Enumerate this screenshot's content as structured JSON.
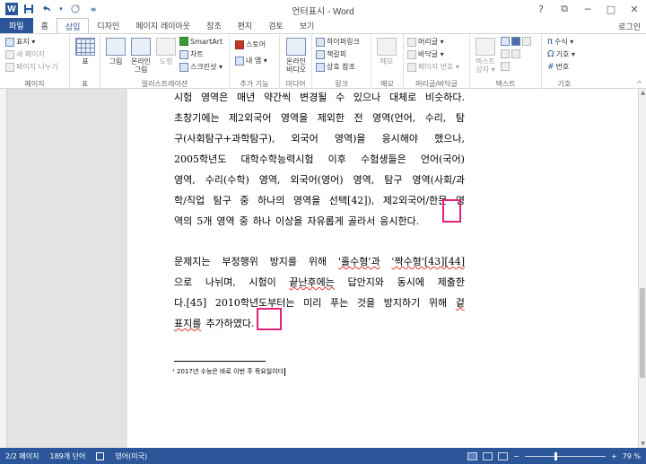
{
  "title_bar": {
    "app_icon": "W",
    "title": "언터표시 - Word",
    "qat_icons": [
      "save-icon",
      "undo-icon",
      "redo-icon",
      "customize-icon"
    ],
    "window_buttons": [
      "?",
      "⧉",
      "─",
      "□",
      "✕"
    ]
  },
  "tabs": [
    {
      "label": "파일"
    },
    {
      "label": "홈"
    },
    {
      "label": "삽입"
    },
    {
      "label": "디자인"
    },
    {
      "label": "페이지 레이아웃"
    },
    {
      "label": "참조"
    },
    {
      "label": "편지"
    },
    {
      "label": "검토"
    },
    {
      "label": "보기"
    }
  ],
  "active_tab": "삽입",
  "login_label": "로그인",
  "ribbon": {
    "pages": {
      "label": "페이지",
      "cover": "표지 ▾",
      "blank": "새 페이지",
      "break": "페이지 나누기"
    },
    "tables": {
      "label": "표",
      "table": "표"
    },
    "illustrations": {
      "label": "일러스트레이션",
      "picture": "그림",
      "online_picture": "온라인 그림",
      "shapes": "도형",
      "smartart": "SmartArt",
      "chart": "차트",
      "screenshot": "스크린샷 ▾"
    },
    "addins": {
      "label": "추가 기능",
      "store": "스토어",
      "my_apps": "내 앱 ▾"
    },
    "media": {
      "label": "미디어",
      "online_video": "온라인 비디오"
    },
    "links": {
      "label": "링크",
      "hyperlink": "하이퍼링크",
      "bookmark": "책갈피",
      "cross_ref": "상호 참조"
    },
    "comments": {
      "label": "메모",
      "comment": "메모"
    },
    "header_footer": {
      "label": "머리글/바닥글",
      "header": "머리글 ▾",
      "footer": "바닥글 ▾",
      "page_number": "페이지 번호 ▾"
    },
    "text": {
      "label": "텍스트",
      "textbox": "텍스트 상자 ▾"
    },
    "symbols": {
      "label": "기호",
      "equation": "수식 ▾",
      "symbol": "기호 ▾",
      "number": "번호"
    }
  },
  "document": {
    "para1": [
      [
        "시험",
        "영역은",
        "매년",
        "약간씩",
        "변경될",
        "수",
        "있으나",
        "대체로",
        "비슷하다."
      ],
      [
        "초창기에는",
        "제2외국어",
        "영역을",
        "제외한",
        "전",
        "영역(언어,",
        "수리,",
        "탐"
      ],
      [
        "구(사회탐구+과학탐구),",
        "외국어",
        "영역)을",
        "응시해야",
        "했으나,"
      ],
      [
        "2005학년도",
        "대학수학능력시험",
        "이후",
        "수험생들은",
        "언어(국어)"
      ],
      [
        "영역,",
        "수리(수학)",
        "영역,",
        "외국어(영어)",
        "영역,",
        "탐구",
        "영역(사회/과"
      ],
      [
        "학/직업",
        "탐구",
        "중",
        "하나의",
        "영역을",
        "선택[42]),",
        "제2외국어/한문",
        "영"
      ]
    ],
    "para1_last": [
      "역의",
      "5개",
      "영역",
      "중",
      "하나",
      "이상을",
      "자유롭게",
      "골라서",
      "응시한다."
    ],
    "para2_l1": [
      "문제지는",
      "부정행위",
      "방지를",
      "위해",
      "'홀수형'과",
      "'짝수형'[43][44]"
    ],
    "para2_l2": [
      "으로",
      "나뉘며,",
      "시험이",
      "끝난후에는",
      "답안지와",
      "동시에",
      "제출한"
    ],
    "para2_l3": [
      "다.[45]",
      "2010학년도부터는",
      "미리",
      "푸는",
      "것을",
      "방지하기",
      "위해",
      "겉"
    ],
    "para2_last": [
      "표지를",
      "추가하였다."
    ],
    "footnote": "¹ 2017년 수능은 바로 이번 주 목요일이다"
  },
  "status_bar": {
    "page": "2/2 페이지",
    "words": "189개 단어",
    "proof_icon": "proofing-icon",
    "language": "영어(미국)",
    "zoom_minus": "−",
    "zoom_plus": "+",
    "zoom": "79 %",
    "zoom_level": 0.79
  }
}
